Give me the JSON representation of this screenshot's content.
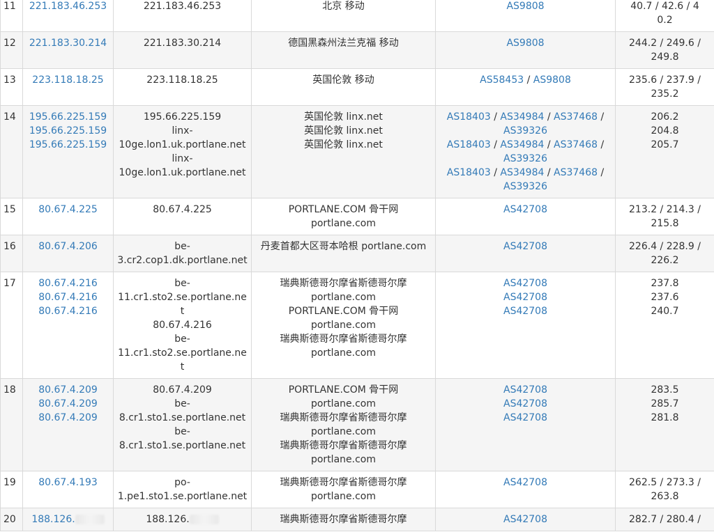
{
  "rows": [
    {
      "hop": "11",
      "ips": [
        "221.183.46.253"
      ],
      "hosts": [
        "221.183.46.253"
      ],
      "geo": [
        "北京 移动"
      ],
      "as": [
        [
          "AS9808"
        ]
      ],
      "lat": [
        "40.7 / 42.6 / 40.2"
      ]
    },
    {
      "hop": "12",
      "ips": [
        "221.183.30.214"
      ],
      "hosts": [
        "221.183.30.214"
      ],
      "geo": [
        "德国黑森州法兰克福 移动"
      ],
      "as": [
        [
          "AS9808"
        ]
      ],
      "lat": [
        "244.2 / 249.6 /",
        "249.8"
      ]
    },
    {
      "hop": "13",
      "ips": [
        "223.118.18.25"
      ],
      "hosts": [
        "223.118.18.25"
      ],
      "geo": [
        "英国伦敦 移动"
      ],
      "as": [
        [
          "AS58453",
          "AS9808"
        ]
      ],
      "lat": [
        "235.6 / 237.9 /",
        "235.2"
      ]
    },
    {
      "hop": "14",
      "ips": [
        "195.66.225.159",
        "195.66.225.159",
        "195.66.225.159"
      ],
      "hosts": [
        "195.66.225.159",
        "linx-",
        "10ge.lon1.uk.portlane.net",
        "linx-",
        "10ge.lon1.uk.portlane.net"
      ],
      "geo": [
        "英国伦敦 linx.net",
        "英国伦敦 linx.net",
        "英国伦敦 linx.net"
      ],
      "as": [
        [
          "AS18403",
          "AS34984",
          "AS37468",
          ""
        ],
        [
          "AS39326"
        ],
        [
          "AS18403",
          "AS34984",
          "AS37468",
          ""
        ],
        [
          "AS39326"
        ],
        [
          "AS18403",
          "AS34984",
          "AS37468",
          ""
        ],
        [
          "AS39326"
        ]
      ],
      "lat": [
        "206.2",
        "204.8",
        "205.7"
      ]
    },
    {
      "hop": "15",
      "ips": [
        "80.67.4.225"
      ],
      "hosts": [
        "80.67.4.225"
      ],
      "geo": [
        "PORTLANE.COM 骨干网",
        "portlane.com"
      ],
      "as": [
        [
          "AS42708"
        ]
      ],
      "lat": [
        "213.2 / 214.3 /",
        "215.8"
      ]
    },
    {
      "hop": "16",
      "ips": [
        "80.67.4.206"
      ],
      "hosts": [
        "be-",
        "3.cr2.cop1.dk.portlane.net"
      ],
      "geo": [
        "丹麦首都大区哥本哈根 portlane.com"
      ],
      "as": [
        [
          "AS42708"
        ]
      ],
      "lat": [
        "226.4 / 228.9 /",
        "226.2"
      ]
    },
    {
      "hop": "17",
      "ips": [
        "80.67.4.216",
        "80.67.4.216",
        "80.67.4.216"
      ],
      "hosts": [
        "be-",
        "11.cr1.sto2.se.portlane.net",
        "80.67.4.216",
        "be-",
        "11.cr1.sto2.se.portlane.net"
      ],
      "geo": [
        "瑞典斯德哥尔摩省斯德哥尔摩",
        "portlane.com",
        "PORTLANE.COM 骨干网",
        "portlane.com",
        "瑞典斯德哥尔摩省斯德哥尔摩",
        "portlane.com"
      ],
      "as": [
        [
          "AS42708"
        ],
        [
          "AS42708"
        ],
        [
          "AS42708"
        ]
      ],
      "lat": [
        "237.8",
        "237.6",
        "240.7"
      ]
    },
    {
      "hop": "18",
      "ips": [
        "80.67.4.209",
        "80.67.4.209",
        "80.67.4.209"
      ],
      "hosts": [
        "80.67.4.209",
        "be-",
        "8.cr1.sto1.se.portlane.net",
        "be-",
        "8.cr1.sto1.se.portlane.net"
      ],
      "geo": [
        "PORTLANE.COM 骨干网",
        "portlane.com",
        "瑞典斯德哥尔摩省斯德哥尔摩",
        "portlane.com",
        "瑞典斯德哥尔摩省斯德哥尔摩",
        "portlane.com"
      ],
      "as": [
        [
          "AS42708"
        ],
        [
          "AS42708"
        ],
        [
          "AS42708"
        ]
      ],
      "lat": [
        "283.5",
        "285.7",
        "281.8"
      ]
    },
    {
      "hop": "19",
      "ips": [
        "80.67.4.193"
      ],
      "hosts": [
        "po-",
        "1.pe1.sto1.se.portlane.net"
      ],
      "geo": [
        "瑞典斯德哥尔摩省斯德哥尔摩",
        "portlane.com"
      ],
      "as": [
        [
          "AS42708"
        ]
      ],
      "lat": [
        "262.5 / 273.3 /",
        "263.8"
      ]
    },
    {
      "hop": "20",
      "ips": [
        "188.126."
      ],
      "hosts": [
        "188.126."
      ],
      "geo": [
        "瑞典斯德哥尔摩省斯德哥尔摩"
      ],
      "as": [
        [
          "AS42708"
        ]
      ],
      "lat": [
        "282.7 / 280.4 /"
      ],
      "redacted": true
    }
  ],
  "colors": {
    "link": "#337ab7",
    "text": "#333333",
    "border": "#d9d9d9",
    "shade": "#f5f5f5"
  }
}
